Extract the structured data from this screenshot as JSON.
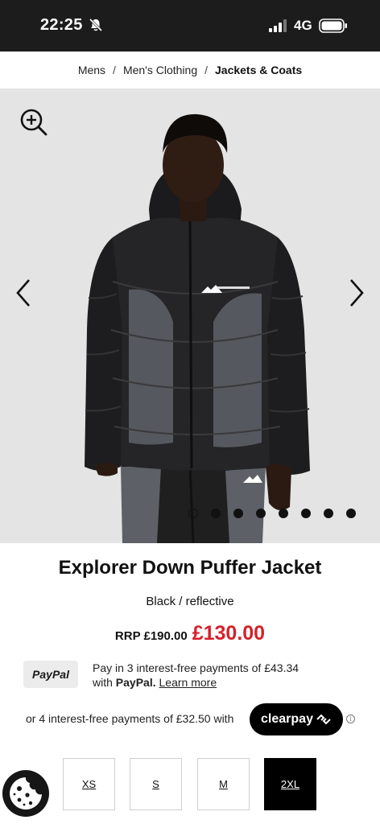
{
  "status_bar": {
    "time": "22:25",
    "network": "4G"
  },
  "breadcrumb": {
    "items": [
      "Mens",
      "Men's Clothing",
      "Jackets & Coats"
    ],
    "separator": "/"
  },
  "gallery": {
    "image_count": 8,
    "active_index": 0,
    "image_brand": "MONTANE"
  },
  "product": {
    "title": "Explorer Down Puffer Jacket",
    "colour": "Black / reflective",
    "rrp": "RRP £190.00",
    "price": "£130.00"
  },
  "paypal": {
    "badge": "PayPal",
    "line1": "Pay in 3 interest-free payments of £43.34",
    "line2_prefix": "with ",
    "line2_brand": "PayPal.",
    "learn_more": "Learn more"
  },
  "clearpay": {
    "text": "or 4 interest-free payments of £32.50 with",
    "badge": "clearpay",
    "info": "i"
  },
  "sizes": [
    {
      "label": "XS",
      "selected": false
    },
    {
      "label": "S",
      "selected": false
    },
    {
      "label": "M",
      "selected": false
    },
    {
      "label": "2XL",
      "selected": true
    }
  ],
  "colors": {
    "sale": "#d6202a",
    "dark": "#1c1c1c",
    "gallery_bg": "#e4e4e4"
  },
  "icons": [
    "bell-slash-icon",
    "signal-icon",
    "battery-icon",
    "zoom-in-icon",
    "chevron-left-icon",
    "chevron-right-icon",
    "cookie-icon",
    "clearpay-arrows-icon",
    "info-icon"
  ]
}
